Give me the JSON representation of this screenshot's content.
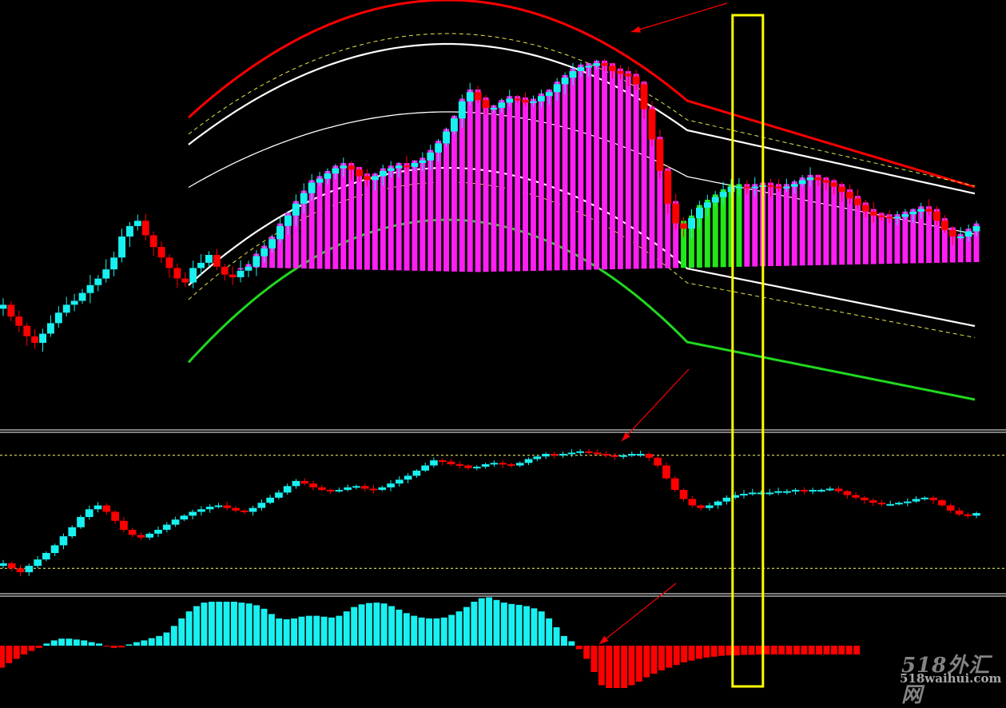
{
  "watermark": {
    "logo": "518外汇网",
    "url": "518waihui.com"
  },
  "colors": {
    "background": "#000000",
    "bull": "#19f0f0",
    "bear": "#ff0000",
    "band_up": "#ff1ff3",
    "band_mid": "#22e81a",
    "outer_band_top": "#ff0000",
    "outer_band_bottom": "#20d820",
    "inner_band": "#ffffff",
    "dash_band": "#e8e84a",
    "highlight": "#ffff00",
    "separator": "#ffffff",
    "osc_level": "#ffff66"
  },
  "chart_data": [
    {
      "type": "candlestick",
      "panel": "price",
      "series_name": "",
      "note": "candles in arbitrary price units; up/down coloured cyan/red, channel-trend bars magenta/green",
      "close": [
        60,
        51,
        44,
        36,
        31,
        38,
        46,
        54,
        60,
        63,
        69,
        75,
        80,
        87,
        96,
        112,
        120,
        124,
        113,
        104,
        96,
        88,
        80,
        77,
        88,
        92,
        98,
        89,
        83,
        81,
        86,
        89,
        97,
        103,
        110,
        120,
        128,
        137,
        145,
        153,
        156,
        160,
        164,
        166,
        163,
        158,
        155,
        158,
        162,
        164,
        166,
        165,
        168,
        170,
        176,
        183,
        192,
        202,
        215,
        222,
        216,
        210,
        210,
        214,
        217,
        216,
        214,
        215,
        219,
        222,
        228,
        233,
        238,
        241,
        242,
        244,
        242,
        238,
        236,
        234,
        228,
        209,
        186,
        162,
        137,
        122,
        118,
        126,
        134,
        138,
        142,
        146,
        150,
        150,
        149,
        150,
        151,
        150,
        149,
        150,
        152,
        155,
        157,
        155,
        153,
        150,
        146,
        141,
        136,
        131,
        128,
        127,
        126,
        127,
        129,
        131,
        133,
        131,
        124,
        117,
        112,
        112,
        116,
        120
      ],
      "band_bars": [
        null,
        null,
        null,
        null,
        null,
        null,
        null,
        null,
        null,
        null,
        null,
        null,
        null,
        null,
        null,
        null,
        null,
        null,
        null,
        null,
        null,
        null,
        null,
        null,
        null,
        null,
        null,
        null,
        null,
        null,
        "up",
        "up",
        "up",
        "up",
        "up",
        "up",
        "up",
        "up",
        "up",
        "up",
        "up",
        "up",
        "up",
        "up",
        "up",
        "up",
        "up",
        "up",
        "up",
        "up",
        "up",
        "up",
        "up",
        "up",
        "up",
        "up",
        "up",
        "up",
        "up",
        "up",
        "up",
        "up",
        "up",
        "up",
        "up",
        "up",
        "up",
        "up",
        "up",
        "up",
        "up",
        "up",
        "up",
        "up",
        "up",
        "up",
        "up",
        "up",
        "up",
        "up",
        "up",
        "up",
        "up",
        "up",
        "up",
        "up",
        "mid",
        "mid",
        "mid",
        "mid",
        "mid",
        "mid",
        "mid",
        "mid",
        "up",
        "up",
        "up",
        "up",
        "up",
        "up",
        "up",
        "up",
        "up",
        "up",
        "up",
        "up",
        "up",
        "up",
        "up",
        "up",
        "up",
        "up",
        "up",
        "up",
        "up",
        "up",
        "up",
        "up",
        "up",
        "up",
        "up",
        "up",
        "up",
        "up"
      ],
      "highlight_bar_index": 94
    },
    {
      "type": "candlestick",
      "panel": "oscillator",
      "series_name": "",
      "levels": [
        0.94,
        0.06
      ],
      "close": [
        0.1,
        0.06,
        0.03,
        0.08,
        0.13,
        0.18,
        0.24,
        0.31,
        0.38,
        0.46,
        0.52,
        0.55,
        0.5,
        0.43,
        0.36,
        0.32,
        0.3,
        0.33,
        0.36,
        0.4,
        0.44,
        0.47,
        0.5,
        0.52,
        0.54,
        0.55,
        0.53,
        0.51,
        0.5,
        0.53,
        0.57,
        0.61,
        0.65,
        0.7,
        0.74,
        0.72,
        0.69,
        0.67,
        0.66,
        0.67,
        0.69,
        0.7,
        0.68,
        0.67,
        0.69,
        0.72,
        0.75,
        0.78,
        0.82,
        0.86,
        0.9,
        0.89,
        0.87,
        0.86,
        0.84,
        0.85,
        0.87,
        0.88,
        0.87,
        0.86,
        0.88,
        0.91,
        0.93,
        0.95,
        0.94,
        0.95,
        0.96,
        0.97,
        0.96,
        0.95,
        0.94,
        0.93,
        0.94,
        0.95,
        0.95,
        0.92,
        0.86,
        0.76,
        0.67,
        0.6,
        0.55,
        0.53,
        0.55,
        0.58,
        0.61,
        0.63,
        0.64,
        0.65,
        0.65,
        0.65,
        0.66,
        0.66,
        0.67,
        0.66,
        0.67,
        0.67,
        0.68,
        0.66,
        0.63,
        0.61,
        0.59,
        0.57,
        0.56,
        0.56,
        0.57,
        0.58,
        0.6,
        0.61,
        0.59,
        0.55,
        0.51,
        0.48,
        0.47,
        0.49
      ]
    },
    {
      "type": "bar",
      "panel": "histogram",
      "series_name": "",
      "values": [
        -0.5,
        -0.4,
        -0.3,
        -0.2,
        -0.12,
        -0.05,
        0.05,
        0.12,
        0.16,
        0.16,
        0.14,
        0.12,
        0.08,
        0.05,
        -0.02,
        -0.05,
        -0.04,
        0.03,
        0.08,
        0.12,
        0.17,
        0.22,
        0.3,
        0.45,
        0.62,
        0.78,
        0.9,
        0.98,
        1.0,
        1.0,
        1.0,
        1.0,
        0.98,
        0.96,
        0.92,
        0.84,
        0.72,
        0.62,
        0.6,
        0.62,
        0.66,
        0.68,
        0.68,
        0.66,
        0.64,
        0.68,
        0.78,
        0.88,
        0.94,
        0.97,
        0.98,
        0.96,
        0.9,
        0.82,
        0.74,
        0.68,
        0.64,
        0.62,
        0.62,
        0.64,
        0.7,
        0.78,
        0.88,
        1.0,
        1.08,
        1.1,
        1.04,
        0.98,
        0.95,
        0.93,
        0.9,
        0.85,
        0.78,
        0.62,
        0.42,
        0.22,
        0.1,
        -0.08,
        -0.3,
        -0.6,
        -0.9,
        -1.1,
        -1.12,
        -1.0,
        -0.9,
        -0.82,
        -0.72,
        -0.64,
        -0.56,
        -0.5,
        -0.44,
        -0.38,
        -0.34,
        -0.3,
        -0.27,
        -0.25,
        -0.23,
        -0.22,
        -0.22,
        -0.21,
        -0.21,
        -0.2,
        -0.2,
        -0.2,
        -0.2,
        -0.2,
        -0.2,
        -0.2,
        -0.2,
        -0.2,
        -0.2,
        -0.2,
        -0.2,
        -0.2,
        -0.2
      ]
    }
  ]
}
